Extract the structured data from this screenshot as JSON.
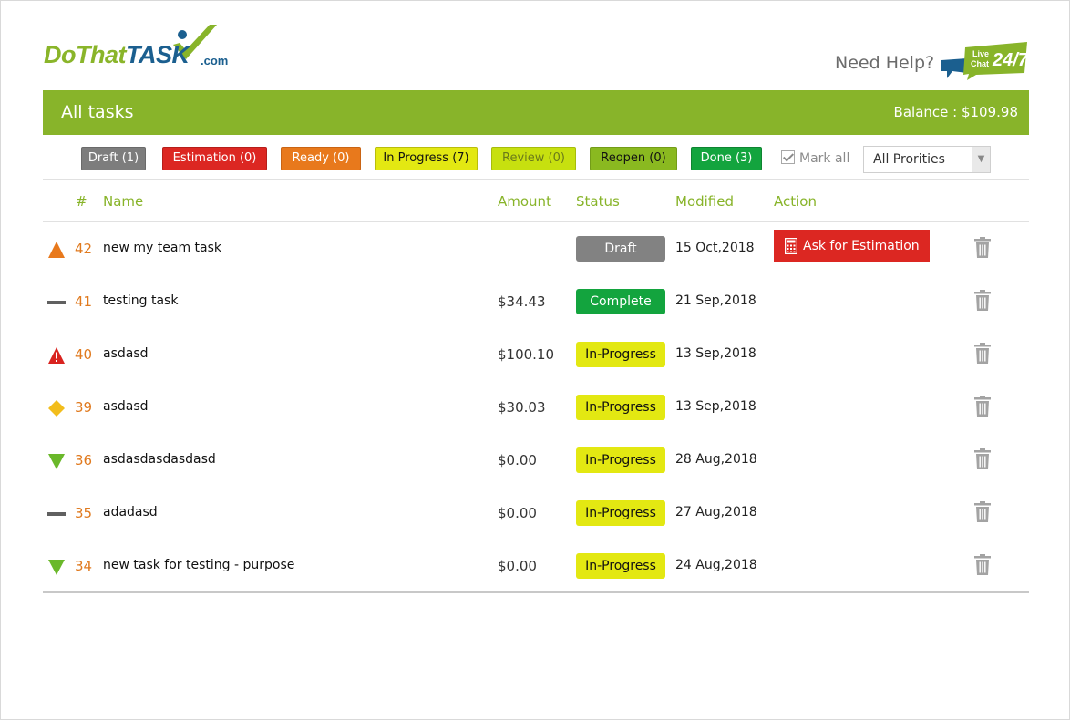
{
  "header": {
    "logo": {
      "part1": "DoThat",
      "part2": "TAS",
      "part3": "K",
      "suffix": ".com"
    },
    "help_text": "Need Help?",
    "chat_badge": {
      "line1": "Live",
      "line2": "Chat",
      "hours": "24/7"
    }
  },
  "topbar": {
    "title": "All tasks",
    "balance": "Balance : $109.98"
  },
  "filters": {
    "buttons": [
      {
        "label": "Draft (1)",
        "bg": "#7d7d7d",
        "color": "#ffffff",
        "border": "#6a6a6a"
      },
      {
        "label": "Estimation (0)",
        "bg": "#dc2722",
        "color": "#ffffff",
        "border": "#b51e1a"
      },
      {
        "label": "Ready (0)",
        "bg": "#e8791c",
        "color": "#ffffff",
        "border": "#c96414"
      },
      {
        "label": "In Progress (7)",
        "bg": "#e3e812",
        "color": "#111111",
        "border": "#b9bd0c"
      },
      {
        "label": "Review (0)",
        "bg": "#c7e00f",
        "color": "#6b7a1a",
        "border": "#a6bc0b"
      },
      {
        "label": "Reopen (0)",
        "bg": "#8ab920",
        "color": "#111111",
        "border": "#739c18"
      },
      {
        "label": "Done (3)",
        "bg": "#13a43e",
        "color": "#ffffff",
        "border": "#0e8431"
      }
    ],
    "mark_all": "Mark all",
    "priority_select": "All Prorities"
  },
  "table": {
    "columns": {
      "num": "#",
      "name": "Name",
      "amount": "Amount",
      "status": "Status",
      "modified": "Modified",
      "action": "Action"
    },
    "rows": [
      {
        "priority": "triangle-up-orange",
        "num": "42",
        "name": "new my team task",
        "amount": "",
        "status": "Draft",
        "status_bg": "#828282",
        "status_color": "#ffffff",
        "modified": "15 Oct,2018",
        "action": "Ask for Estimation"
      },
      {
        "priority": "dash-gray",
        "num": "41",
        "name": "testing task",
        "amount": "$34.43",
        "status": "Complete",
        "status_bg": "#13a43e",
        "status_color": "#ffffff",
        "modified": "21 Sep,2018",
        "action": ""
      },
      {
        "priority": "warning-red",
        "num": "40",
        "name": "asdasd",
        "amount": "$100.10",
        "status": "In-Progress",
        "status_bg": "#e3e812",
        "status_color": "#111111",
        "modified": "13 Sep,2018",
        "action": ""
      },
      {
        "priority": "diamond-yellow",
        "num": "39",
        "name": "asdasd",
        "amount": "$30.03",
        "status": "In-Progress",
        "status_bg": "#e3e812",
        "status_color": "#111111",
        "modified": "13 Sep,2018",
        "action": ""
      },
      {
        "priority": "triangle-down-green",
        "num": "36",
        "name": "asdasdasdasdasd",
        "amount": "$0.00",
        "status": "In-Progress",
        "status_bg": "#e3e812",
        "status_color": "#111111",
        "modified": "28 Aug,2018",
        "action": ""
      },
      {
        "priority": "dash-gray",
        "num": "35",
        "name": "adadasd",
        "amount": "$0.00",
        "status": "In-Progress",
        "status_bg": "#e3e812",
        "status_color": "#111111",
        "modified": "27 Aug,2018",
        "action": ""
      },
      {
        "priority": "triangle-down-green",
        "num": "34",
        "name": "new task for testing - purpose",
        "amount": "$0.00",
        "status": "In-Progress",
        "status_bg": "#e3e812",
        "status_color": "#111111",
        "modified": "24 Aug,2018",
        "action": ""
      }
    ]
  },
  "colors": {
    "brand_green": "#88b42a",
    "brand_blue": "#1b5f8f",
    "number_orange": "#e07a1f",
    "trash_gray": "#a3a3a3"
  }
}
